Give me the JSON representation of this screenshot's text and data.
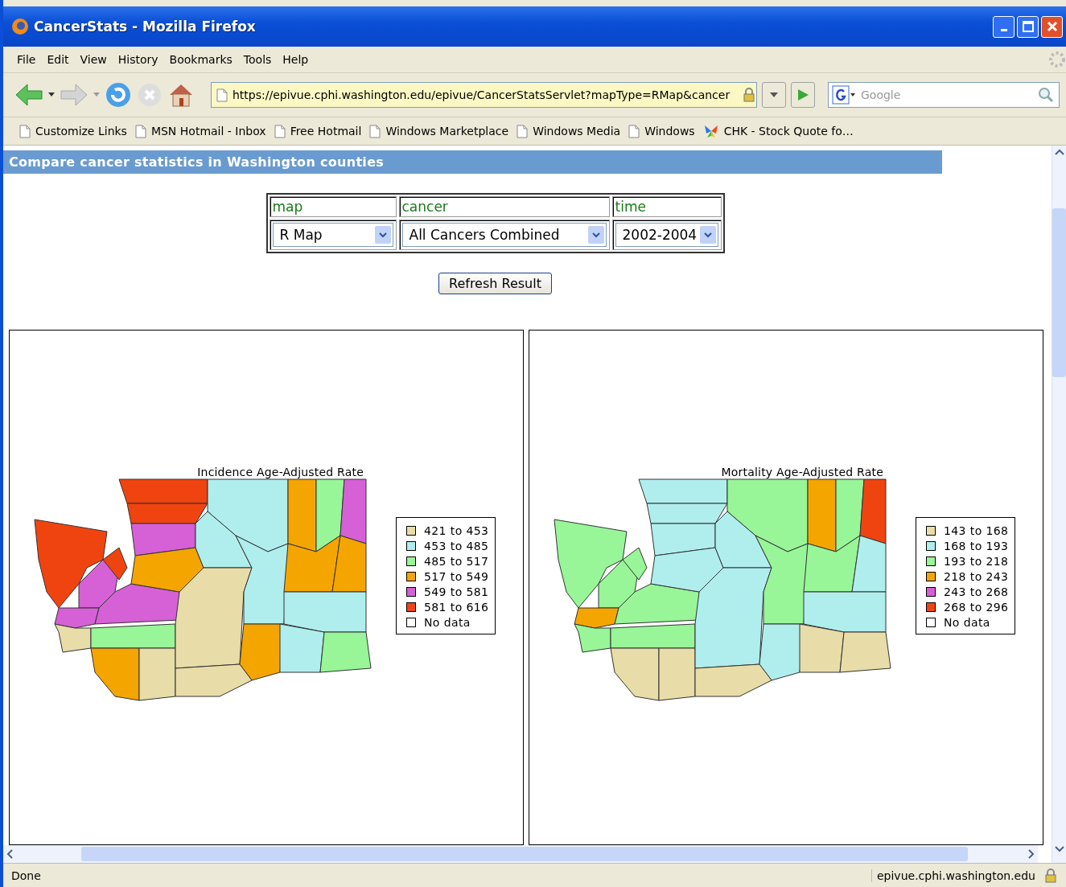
{
  "window": {
    "title": "CancerStats - Mozilla Firefox"
  },
  "menu": [
    "File",
    "Edit",
    "View",
    "History",
    "Bookmarks",
    "Tools",
    "Help"
  ],
  "address_bar": {
    "url": "https://epivue.cphi.washington.edu/epivue/CancerStatsServlet?mapType=RMap&cancer"
  },
  "search": {
    "placeholder": "Google"
  },
  "bookmarks": [
    {
      "label": "Customize Links",
      "kind": "page"
    },
    {
      "label": "MSN Hotmail - Inbox",
      "kind": "page"
    },
    {
      "label": "Free Hotmail",
      "kind": "page"
    },
    {
      "label": "Windows Marketplace",
      "kind": "page"
    },
    {
      "label": "Windows Media",
      "kind": "page"
    },
    {
      "label": "Windows",
      "kind": "page"
    },
    {
      "label": "CHK - Stock Quote fo…",
      "kind": "logo"
    }
  ],
  "page": {
    "heading": "Compare cancer statistics in Washington counties",
    "form": [
      {
        "label": "map",
        "value": "R Map"
      },
      {
        "label": "cancer",
        "value": "All Cancers Combined"
      },
      {
        "label": "time",
        "value": "2002-2004"
      }
    ],
    "button": "Refresh Result",
    "maps": [
      {
        "title": "Incidence Age-Adjusted Rate",
        "legend": [
          {
            "label": "421 to 453",
            "color": "#e8dca8"
          },
          {
            "label": "453 to 485",
            "color": "#b0eeee"
          },
          {
            "label": "485 to 517",
            "color": "#98f598"
          },
          {
            "label": "517 to 549",
            "color": "#f5a500"
          },
          {
            "label": "549 to 581",
            "color": "#d660d6"
          },
          {
            "label": "581 to 616",
            "color": "#f04410"
          },
          {
            "label": "No data",
            "color": "#ffffff"
          }
        ]
      },
      {
        "title": "Mortality Age-Adjusted Rate",
        "legend": [
          {
            "label": "143 to 168",
            "color": "#e8dca8"
          },
          {
            "label": "168 to 193",
            "color": "#b0eeee"
          },
          {
            "label": "193 to 218",
            "color": "#98f598"
          },
          {
            "label": "218 to 243",
            "color": "#f5a500"
          },
          {
            "label": "243 to 268",
            "color": "#d660d6"
          },
          {
            "label": "268 to 296",
            "color": "#f04410"
          },
          {
            "label": "No data",
            "color": "#ffffff"
          }
        ]
      }
    ]
  },
  "status_bar": {
    "text": "Done",
    "host": "epivue.cphi.washington.edu"
  }
}
